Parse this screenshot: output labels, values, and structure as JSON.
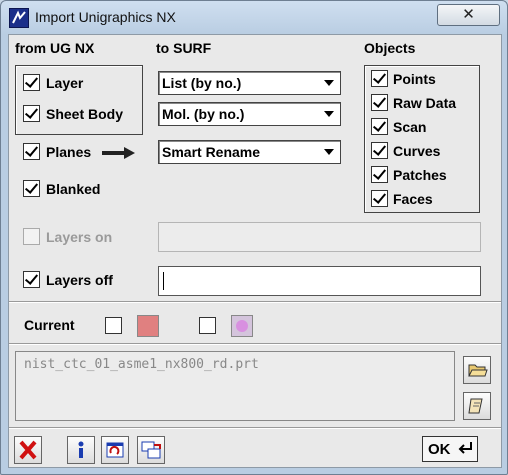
{
  "window": {
    "title": "Import Unigraphics NX",
    "close_glyph": "✕"
  },
  "headers": {
    "from": "from UG NX",
    "to": "to SURF",
    "objects": "Objects"
  },
  "from_items": [
    {
      "label": "Layer",
      "checked": true
    },
    {
      "label": "Sheet Body",
      "checked": true
    },
    {
      "label": "Planes",
      "checked": true
    },
    {
      "label": "Blanked",
      "checked": true
    }
  ],
  "to_selects": [
    {
      "value": "List (by no.)"
    },
    {
      "value": "Mol. (by no.)"
    },
    {
      "value": "Smart Rename"
    }
  ],
  "objects": [
    {
      "label": "Points",
      "checked": true
    },
    {
      "label": "Raw Data",
      "checked": true
    },
    {
      "label": "Scan",
      "checked": true
    },
    {
      "label": "Curves",
      "checked": true
    },
    {
      "label": "Patches",
      "checked": true
    },
    {
      "label": "Faces",
      "checked": true
    }
  ],
  "layers_on": {
    "label": "Layers on",
    "checked": false,
    "enabled": false,
    "value": ""
  },
  "layers_off": {
    "label": "Layers off",
    "checked": true,
    "value": ""
  },
  "current": {
    "label": "Current",
    "color1": "#e08080",
    "color2": "#d890e0"
  },
  "file": {
    "path": "nist_ctc_01_asme1_nx800_rd.prt"
  },
  "buttons": {
    "ok": "OK"
  },
  "colors": {
    "cancel": "#d01010",
    "info": "#1a3cb0"
  }
}
